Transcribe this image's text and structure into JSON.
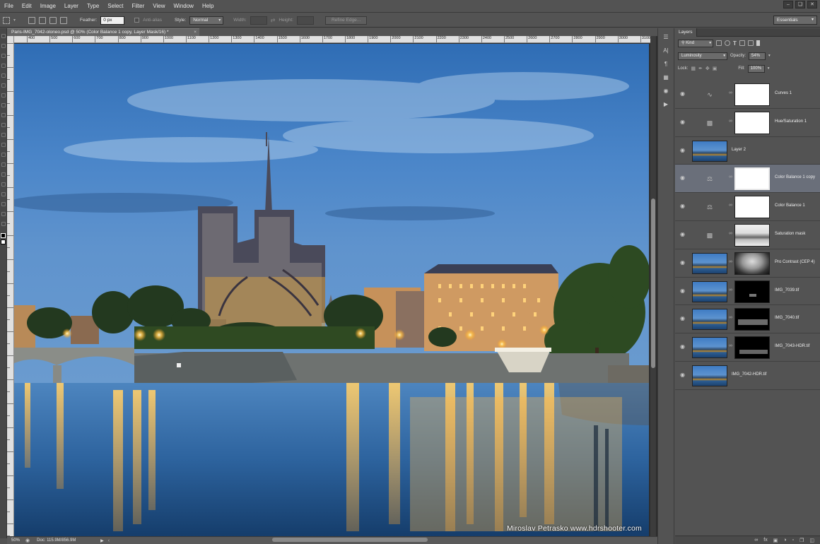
{
  "menu": [
    "File",
    "Edit",
    "Image",
    "Layer",
    "Type",
    "Select",
    "Filter",
    "View",
    "Window",
    "Help"
  ],
  "options": {
    "feather_label": "Feather:",
    "feather_value": "0 px",
    "antialias_label": "Anti-alias",
    "style_label": "Style:",
    "style_value": "Normal",
    "width_label": "Width:",
    "height_label": "Height:",
    "refine_edge": "Refine Edge...",
    "workspace": "Essentials"
  },
  "document": {
    "tab_title": "Paris-IMG_7042-oloneo.psd @ 50% (Color Balance 1 copy, Layer Mask/16) *",
    "tab_close": "×",
    "watermark": "Miroslav  Petrasko  www.hdrshooter.com",
    "ruler_ticks": [
      "400",
      "500",
      "600",
      "700",
      "800",
      "900",
      "1000",
      "1100",
      "1200",
      "1300",
      "1400",
      "1500",
      "1600",
      "1700",
      "1800",
      "1900",
      "2000",
      "2100",
      "2200",
      "2300",
      "2400",
      "2500",
      "2600",
      "2700",
      "2800",
      "2900",
      "3000",
      "3100"
    ]
  },
  "status": {
    "zoom": "50%",
    "doc_size": "Doc: 115.9M/856.9M"
  },
  "layers_panel": {
    "tab": "Layers",
    "kind": "Kind",
    "blend_mode": "Luminosity",
    "opacity_label": "Opacity:",
    "opacity_value": "54%",
    "lock_label": "Lock:",
    "fill_label": "Fill:",
    "fill_value": "100%",
    "layers": [
      {
        "name": "Curves 1"
      },
      {
        "name": "Hue/Saturation 1"
      },
      {
        "name": "Layer 2"
      },
      {
        "name": "Color Balance 1 copy"
      },
      {
        "name": "Color Balance 1"
      },
      {
        "name": "Saturation mask"
      },
      {
        "name": "Pro Contrast (CEP 4)"
      },
      {
        "name": "IMG_7039.tif"
      },
      {
        "name": "IMG_7040.tif"
      },
      {
        "name": "IMG_7043-HDR.tif"
      },
      {
        "name": "IMG_7042-HDR.tif"
      }
    ]
  }
}
